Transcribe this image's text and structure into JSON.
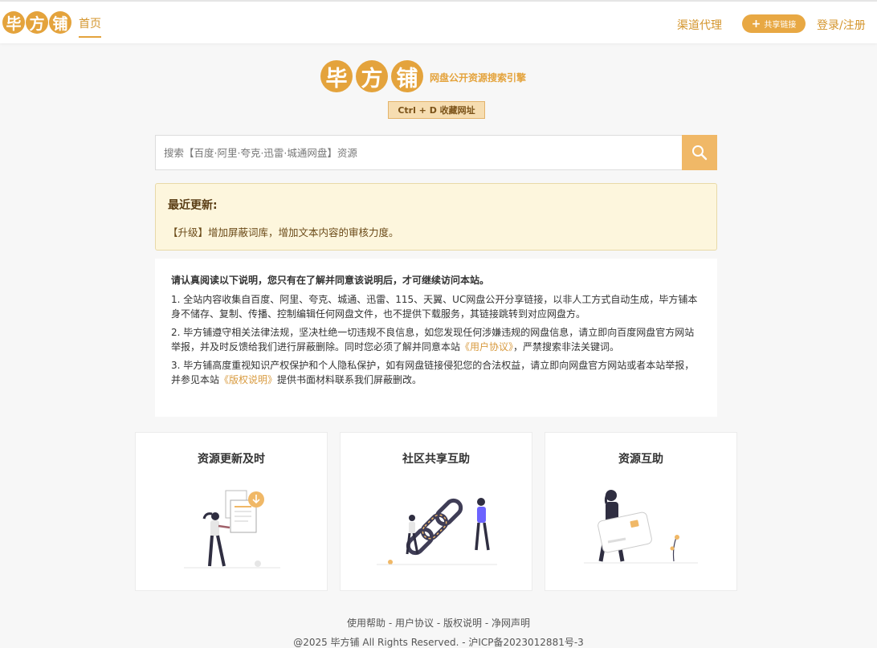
{
  "header": {
    "logo_chars": [
      "毕",
      "方",
      "铺"
    ],
    "nav_home": "首页",
    "nav_agent": "渠道代理",
    "share_label": "共享链接",
    "login_label": "登录/注册"
  },
  "brand": {
    "logo_chars": [
      "毕",
      "方",
      "铺"
    ],
    "subtitle": "网盘公开资源搜索引擎",
    "bookmark_hint": "Ctrl + D 收藏网址"
  },
  "search": {
    "placeholder": "搜索【百度·阿里·夸克·迅雷·城通网盘】资源"
  },
  "updates": {
    "title": "最近更新:",
    "text": "【升级】增加屏蔽词库，增加文本内容的审核力度。"
  },
  "notice": {
    "lead": "请认真阅读以下说明，您只有在了解并同意该说明后，才可继续访问本站。",
    "p1": "1. 全站内容收集自百度、阿里、夸克、城通、迅雷、115、天翼、UC网盘公开分享链接，以非人工方式自动生成，毕方铺本身不储存、复制、传播、控制编辑任何网盘文件，也不提供下载服务，其链接跳转到对应网盘方。",
    "p2_before": "2. 毕方铺遵守相关法律法规，坚决杜绝一切违规不良信息，如您发现任何涉嫌违规的网盘信息，请立即向百度网盘官方网站举报，并及时反馈给我们进行屏蔽删除。同时您必须了解并同意本站",
    "p2_link": "《用户协议》",
    "p2_after": "，严禁搜索非法关键词。",
    "p3_before": "3. 毕方铺高度重视知识产权保护和个人隐私保护，如有网盘链接侵犯您的合法权益，请立即向网盘官方网站或者本站举报，并参见本站",
    "p3_link": "《版权说明》",
    "p3_after": "提供书面材料联系我们屏蔽删改。"
  },
  "cards": [
    {
      "title": "资源更新及时"
    },
    {
      "title": "社区共享互助"
    },
    {
      "title": "资源互助"
    }
  ],
  "footer": {
    "links": [
      "使用帮助",
      "用户协议",
      "版权说明",
      "净网声明"
    ],
    "separator": " - ",
    "copyright": "@2025 毕方铺 All Rights Reserved. - 沪ICP备2023012881号-3"
  },
  "colors": {
    "accent": "#e4a33c",
    "accent_text": "#d4952c",
    "update_bg": "#fdf6dd"
  }
}
